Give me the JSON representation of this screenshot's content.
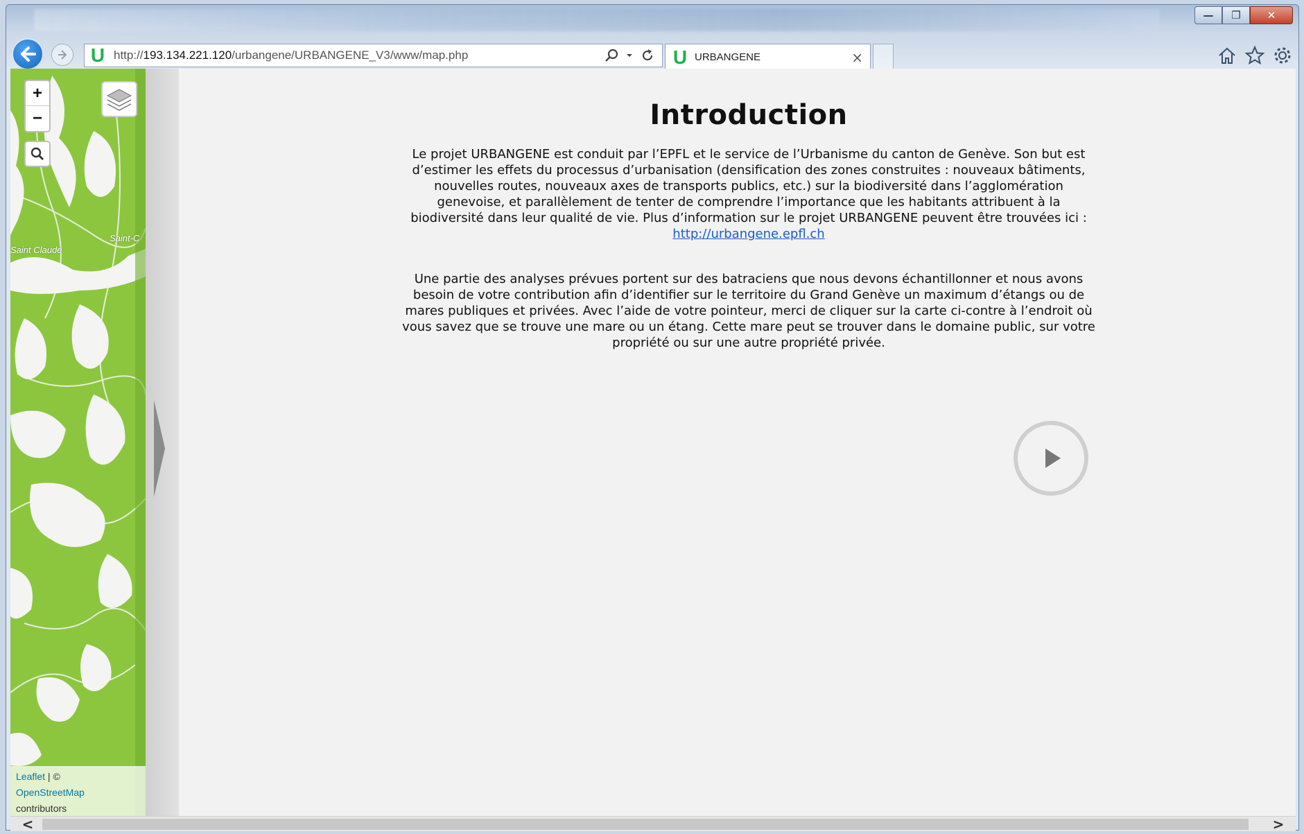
{
  "window": {
    "minimize_label": "—",
    "restore_label": "❐",
    "close_label": "✕"
  },
  "navbar": {
    "url_prefix": "http://",
    "url_host": "193.134.221.120",
    "url_path": "/urbangene/URBANGENE_V3/www/map.php",
    "site_icon": "U",
    "tab_title": "URBANGENE"
  },
  "map": {
    "zoom_in_label": "+",
    "zoom_out_label": "−",
    "place_labels": [
      "Saint Claude",
      "Saint-C"
    ],
    "attribution": {
      "leaflet": "Leaflet",
      "separator": " | ©",
      "osm": "OpenStreetMap",
      "contributors": "contributors"
    }
  },
  "intro": {
    "title": "Introduction",
    "paragraph1": "Le projet URBANGENE est conduit par l’EPFL et le service de l’Urbanisme du canton de Genève. Son but est d’estimer les effets du processus d’urbanisation (densification des zones construites : nouveaux bâtiments, nouvelles routes, nouveaux axes de transports publics, etc.) sur la biodiversité dans l’agglomération genevoise, et parallèlement de tenter de comprendre l’importance que les habitants attribuent à la biodiversité dans leur qualité de vie. Plus d’information sur le projet URBANGENE peuvent être trouvées ici : ",
    "link": "http://urbangene.epfl.ch",
    "paragraph2": "Une partie des analyses prévues portent sur des batraciens que nous devons échantillonner et nous avons besoin de votre contribution afin d’identifier sur le territoire du Grand Genève un maximum d’étangs ou de mares publiques et privées. Avec l’aide de votre pointeur, merci de cliquer sur la carte ci-contre à l’endroit où vous savez que se trouve une mare ou un étang. Cette mare peut se trouver dans le domaine public, sur votre propriété ou sur une autre propriété privée."
  },
  "scrollbar": {
    "left_arrow": "<",
    "right_arrow": ">"
  },
  "colors": {
    "map_green": "#8cc63f",
    "link_blue": "#1a5fc4",
    "site_icon_green": "#22b14c"
  }
}
